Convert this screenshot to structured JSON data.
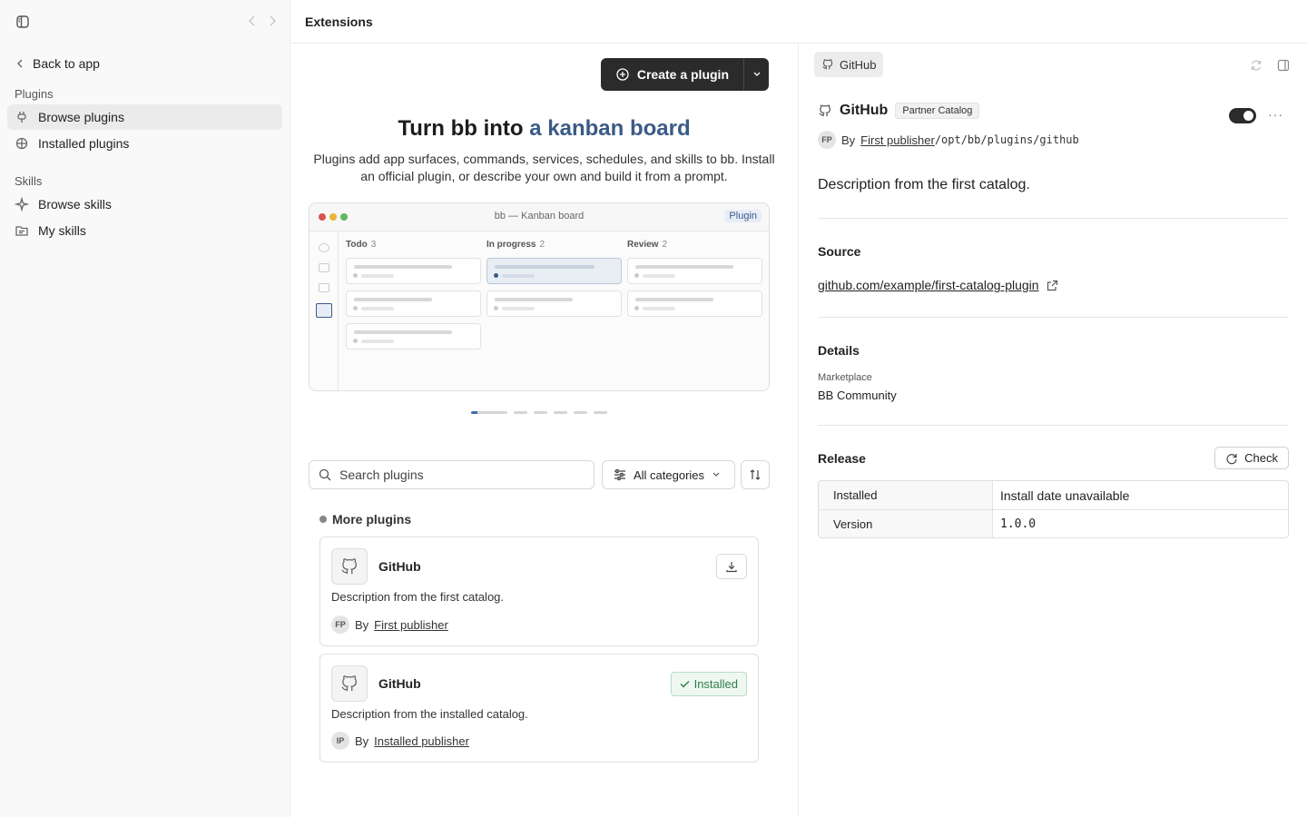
{
  "sidebar": {
    "back_label": "Back to app",
    "sections": [
      {
        "title": "Plugins",
        "items": [
          {
            "label": "Browse plugins",
            "active": true
          },
          {
            "label": "Installed plugins"
          }
        ]
      },
      {
        "title": "Skills",
        "items": [
          {
            "label": "Browse skills"
          },
          {
            "label": "My skills"
          }
        ]
      }
    ]
  },
  "header": {
    "title": "Extensions"
  },
  "main": {
    "create_label": "Create a plugin",
    "hero": {
      "title_prefix": "Turn bb into ",
      "title_accent": "a kanban board",
      "description": "Plugins add app surfaces, commands, services, schedules, and skills to bb. Install an official plugin, or describe your own and build it from a prompt."
    },
    "preview": {
      "window_title": "bb — Kanban board",
      "badge": "Plugin",
      "columns": [
        {
          "name": "Todo",
          "count": "3"
        },
        {
          "name": "In progress",
          "count": "2"
        },
        {
          "name": "Review",
          "count": "2"
        }
      ]
    },
    "search": {
      "placeholder": "Search plugins"
    },
    "category_label": "All categories",
    "list_heading": "More plugins",
    "plugins": [
      {
        "name": "GitHub",
        "description": "Description from the first catalog.",
        "publisher_initials": "FP",
        "by": "By",
        "publisher": "First publisher",
        "action": "download"
      },
      {
        "name": "GitHub",
        "description": "Description from the installed catalog.",
        "publisher_initials": "IP",
        "by": "By",
        "publisher": "Installed publisher",
        "action": "installed",
        "installed_label": "Installed"
      }
    ]
  },
  "detail": {
    "tab_label": "GitHub",
    "name": "GitHub",
    "tag": "Partner Catalog",
    "enabled": true,
    "publisher_initials": "FP",
    "by": "By",
    "publisher": "First publisher",
    "path": "/opt/bb/plugins/github",
    "description": "Description from the first catalog.",
    "source_title": "Source",
    "source_link": "github.com/example/first-catalog-plugin",
    "details_title": "Details",
    "marketplace_label": "Marketplace",
    "marketplace_value": "BB Community",
    "release_title": "Release",
    "check_label": "Check",
    "release_rows": [
      {
        "key": "Installed",
        "value": "Install date unavailable"
      },
      {
        "key": "Version",
        "value": "1.0.0"
      }
    ]
  },
  "colors": {
    "accent": "#3b5b86",
    "dark_button": "#2b2b2b",
    "installed_green": "#2e7d48"
  }
}
